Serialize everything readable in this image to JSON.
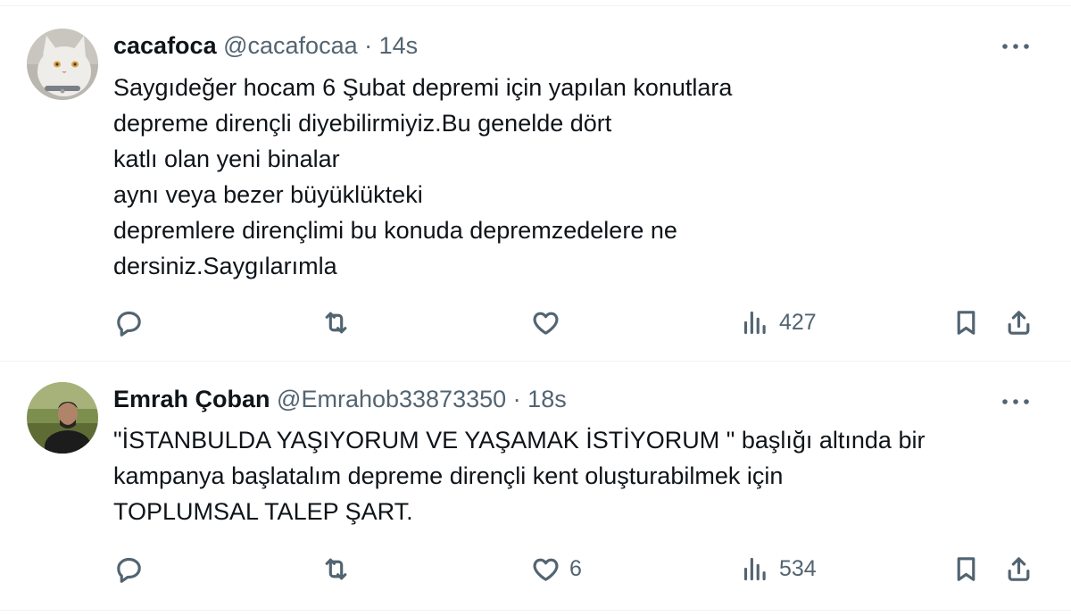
{
  "tweets": [
    {
      "name": "cacafoca",
      "handle": "@cacafocaa",
      "separator": "·",
      "time": "14s",
      "text": "Saygıdeğer hocam 6 Şubat depremi için yapılan konutlara\ndepreme dirençli diyebilirmiyiz.Bu genelde dört\nkatlı olan yeni binalar\naynı veya bezer büyüklükteki\ndepremlere dirençlimi bu konuda depremzedelere ne\ndersiniz.Saygılarımla",
      "reply_count": "",
      "retweet_count": "",
      "like_count": "",
      "view_count": "427",
      "avatar_icon": "white-cat-avatar"
    },
    {
      "name": "Emrah Çoban",
      "handle": "@Emrahob33873350",
      "separator": "·",
      "time": "18s",
      "text": "\"İSTANBULDA YAŞIYORUM VE YAŞAMAK İSTİYORUM \" başlığı altında bir\nkampanya başlatalım depreme dirençli kent oluşturabilmek için\nTOPLUMSAL TALEP ŞART.",
      "reply_count": "",
      "retweet_count": "",
      "like_count": "6",
      "view_count": "534",
      "avatar_icon": "man-outdoors-avatar"
    }
  ],
  "colors": {
    "text": "#0f1419",
    "secondary": "#536471",
    "divider": "#eff3f4"
  }
}
